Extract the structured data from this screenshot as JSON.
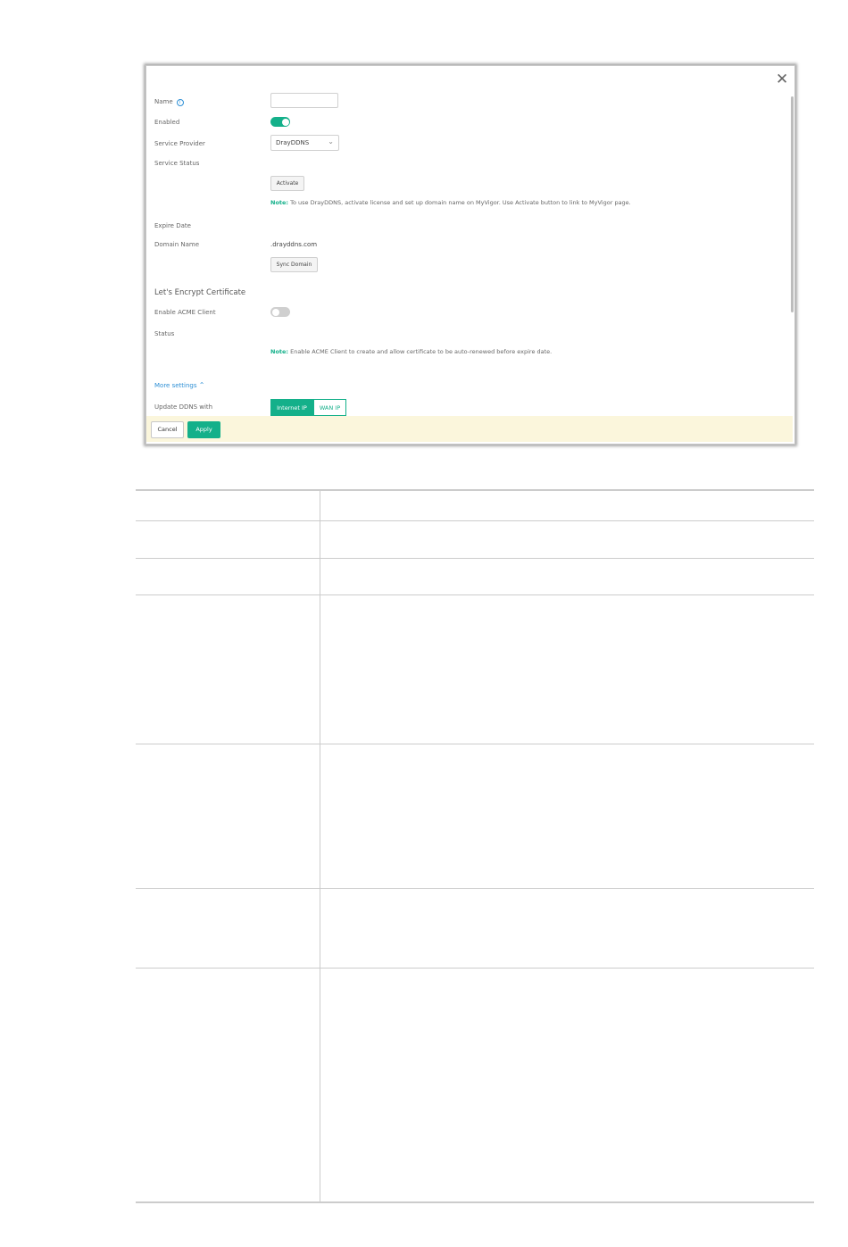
{
  "dialog": {
    "close_glyph": "✕",
    "fields": {
      "name_label": "Name",
      "name_value": "",
      "enabled_label": "Enabled",
      "enabled_on": true,
      "service_provider_label": "Service Provider",
      "service_provider_value": "DrayDDNS",
      "service_status_label": "Service Status",
      "activate_button": "Activate",
      "note1_tag": "Note:",
      "note1_text": " To use DrayDDNS, activate license and set up domain name on MyVigor. Use Activate button to link to MyVigor page.",
      "expire_date_label": "Expire Date",
      "domain_name_label": "Domain Name",
      "domain_name_value": ".drayddns.com",
      "sync_domain_button": "Sync Domain",
      "lets_encrypt_title": "Let's Encrypt Certificate",
      "enable_acme_label": "Enable ACME Client",
      "enable_acme_on": false,
      "status_label": "Status",
      "note2_tag": "Note:",
      "note2_text": " Enable ACME Client to create and allow certificate to be auto-renewed before expire date.",
      "more_settings": "More settings",
      "update_ddns_label": "Update DDNS with",
      "update_options": [
        "Internet IP",
        "WAN IP"
      ],
      "update_selected": "Internet IP"
    },
    "footer": {
      "cancel": "Cancel",
      "apply": "Apply"
    }
  },
  "colors": {
    "accent": "#14b08a",
    "link": "#2d8fd5",
    "footer_bg": "#fbf6dc"
  }
}
